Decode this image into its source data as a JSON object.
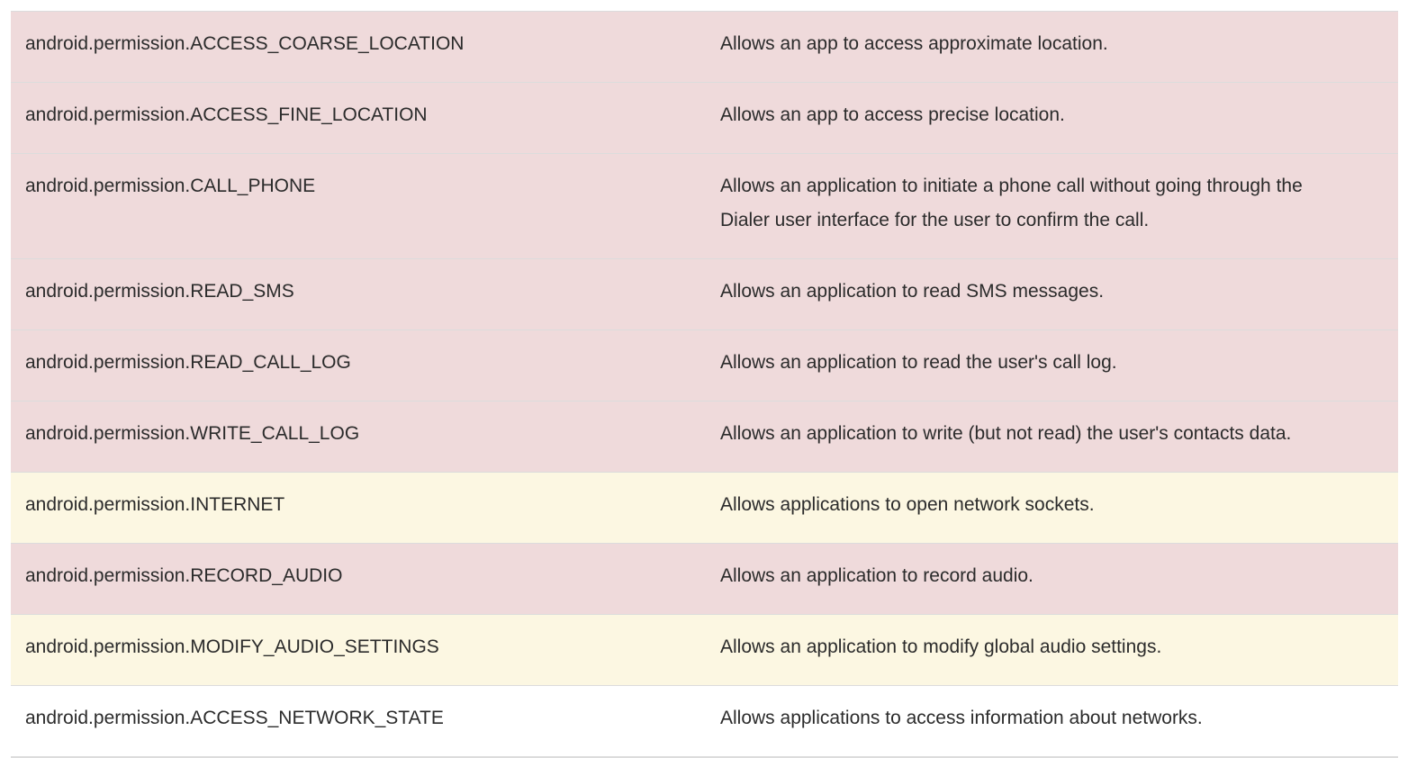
{
  "colors": {
    "dangerous": "#efdadb",
    "warning": "#fcf7e2",
    "normal": "#ffffff",
    "border": "#dcdcdc",
    "text": "#2b2b2b"
  },
  "rows": [
    {
      "permission": "android.permission.ACCESS_COARSE_LOCATION",
      "description": "Allows an app to access approximate location.",
      "level": "dangerous"
    },
    {
      "permission": "android.permission.ACCESS_FINE_LOCATION",
      "description": "Allows an app to access precise location.",
      "level": "dangerous"
    },
    {
      "permission": "android.permission.CALL_PHONE",
      "description": "Allows an application to initiate a phone call without going through the Dialer user interface for the user to confirm the call.",
      "level": "dangerous"
    },
    {
      "permission": "android.permission.READ_SMS",
      "description": "Allows an application to read SMS messages.",
      "level": "dangerous"
    },
    {
      "permission": "android.permission.READ_CALL_LOG",
      "description": "Allows an application to read the user's call log.",
      "level": "dangerous"
    },
    {
      "permission": "android.permission.WRITE_CALL_LOG",
      "description": "Allows an application to write (but not read) the user's contacts data.",
      "level": "dangerous"
    },
    {
      "permission": "android.permission.INTERNET",
      "description": "Allows applications to open network sockets.",
      "level": "warning"
    },
    {
      "permission": "android.permission.RECORD_AUDIO",
      "description": "Allows an application to record audio.",
      "level": "dangerous"
    },
    {
      "permission": "android.permission.MODIFY_AUDIO_SETTINGS",
      "description": "Allows an application to modify global audio settings.",
      "level": "warning"
    },
    {
      "permission": "android.permission.ACCESS_NETWORK_STATE",
      "description": "Allows applications to access information about networks.",
      "level": "normal"
    }
  ]
}
